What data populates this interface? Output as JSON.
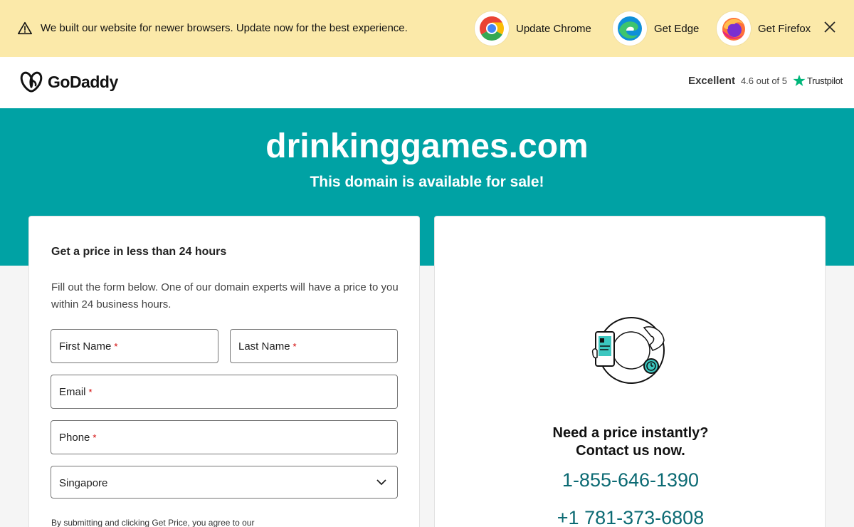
{
  "banner": {
    "message": "We built our website for newer browsers. Update now for the best experience.",
    "browsers": [
      {
        "label": "Update Chrome",
        "icon": "chrome-icon"
      },
      {
        "label": "Get Edge",
        "icon": "edge-icon"
      },
      {
        "label": "Get Firefox",
        "icon": "firefox-icon"
      }
    ],
    "bg_color": "#fbe9a9"
  },
  "header": {
    "brand": "GoDaddy",
    "rating_word": "Excellent",
    "rating_score": "4.6 out of 5",
    "trustpilot": "Trustpilot"
  },
  "hero": {
    "domain": "drinkinggames.com",
    "subtitle": "This domain is available for sale!",
    "bg_color": "#00a2a4"
  },
  "form": {
    "title": "Get a price in less than 24 hours",
    "description": "Fill out the form below. One of our domain experts will have a price to you within 24 business hours.",
    "first_name": "First Name",
    "last_name": "Last Name",
    "email": "Email",
    "phone": "Phone",
    "required_mark": "*",
    "country": "Singapore",
    "fine_print": "By submitting and clicking Get Price, you agree to our"
  },
  "contact": {
    "question_line1": "Need a price instantly?",
    "question_line2": "Contact us now.",
    "phone_primary": "1-855-646-1390",
    "phone_secondary": "+1 781-373-6808",
    "link_color": "#0b6a73"
  }
}
